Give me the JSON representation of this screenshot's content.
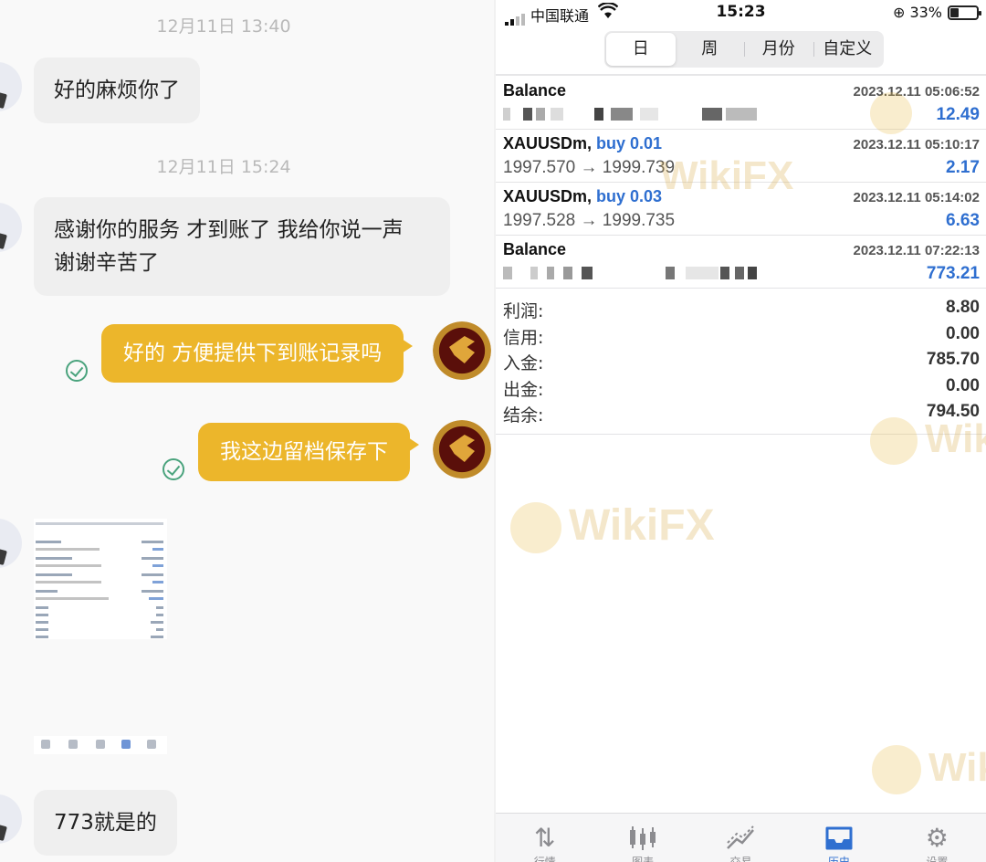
{
  "chat": {
    "messages": [
      {
        "timestamp": "12月11日 13:40"
      },
      {
        "text": "好的麻烦你了"
      },
      {
        "timestamp": "12月11日 15:24"
      },
      {
        "text_line1": "感谢你的服务 才到账了 我给你说一声",
        "text_line2": "谢谢辛苦了"
      },
      {
        "text": "好的 方便提供下到账记录吗"
      },
      {
        "text": "我这边留档保存下"
      },
      {
        "text": "773就是的"
      }
    ]
  },
  "history": {
    "status_bar": {
      "carrier": "中国联通",
      "time": "15:23",
      "battery": "33%"
    },
    "periods": [
      "日",
      "周",
      "月份",
      "自定义"
    ],
    "active_period": "日",
    "deals": [
      {
        "symbol": "Balance",
        "side": "",
        "datetime": "2023.12.11 05:06:52",
        "prices": "",
        "profit": "12.49"
      },
      {
        "symbol": "XAUUSDm,",
        "side": "buy 0.01",
        "datetime": "2023.12.11 05:10:17",
        "prices": "1997.570 → 1999.739",
        "profit": "2.17"
      },
      {
        "symbol": "XAUUSDm,",
        "side": "buy 0.03",
        "datetime": "2023.12.11 05:14:02",
        "prices": "1997.528 → 1999.735",
        "profit": "6.63"
      },
      {
        "symbol": "Balance",
        "side": "",
        "datetime": "2023.12.11 07:22:13",
        "prices": "",
        "profit": "773.21"
      }
    ],
    "summary": [
      {
        "label": "利润:",
        "value": "8.80"
      },
      {
        "label": "信用:",
        "value": "0.00"
      },
      {
        "label": "入金:",
        "value": "785.70"
      },
      {
        "label": "出金:",
        "value": "0.00"
      },
      {
        "label": "结余:",
        "value": "794.50"
      }
    ],
    "tabs": [
      {
        "label": "行情",
        "icon": "quotes-icon"
      },
      {
        "label": "图表",
        "icon": "chart-icon"
      },
      {
        "label": "交易",
        "icon": "trade-icon"
      },
      {
        "label": "历史",
        "icon": "history-icon"
      },
      {
        "label": "设置",
        "icon": "settings-icon"
      }
    ],
    "active_tab": "历史"
  },
  "watermark": "WikiFX",
  "colors": {
    "accent_blue": "#2f6fd0",
    "bubble_yellow": "#ecb62b",
    "check_green": "#4aa37d"
  }
}
